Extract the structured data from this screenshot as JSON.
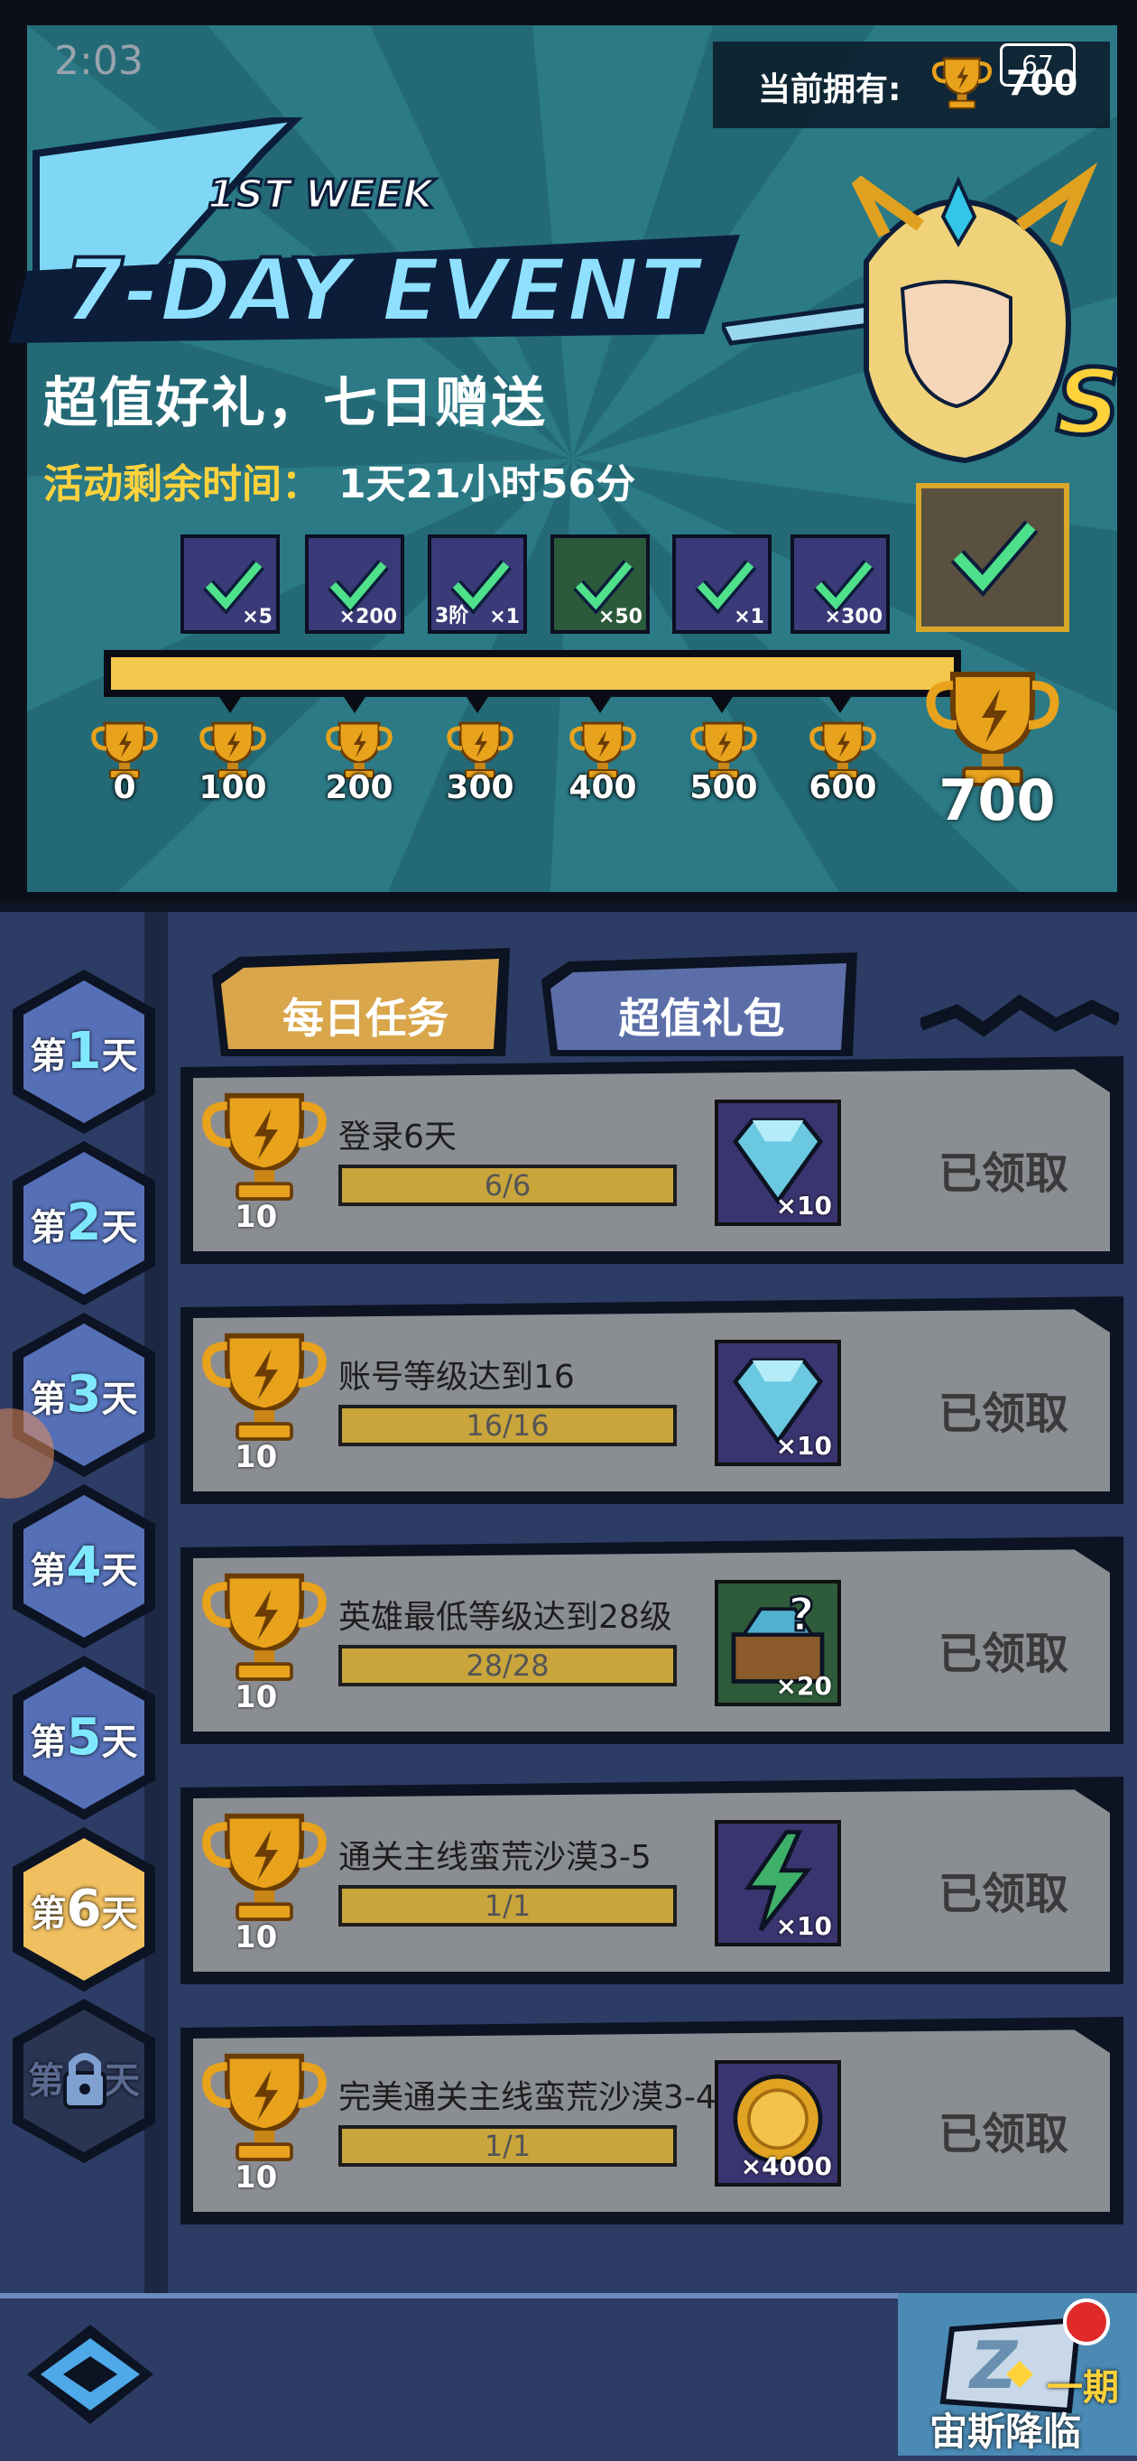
{
  "status_bar": {
    "time": "2:03",
    "battery": "67"
  },
  "header": {
    "own_label": "当前拥有:",
    "own_value": "700",
    "logo_week": "1ST WEEK",
    "logo_title": "7-DAY EVENT",
    "subtitle": "超值好礼，七日赠送",
    "timer_label": "活动剩余时间：",
    "timer_value": "1天21小时56分"
  },
  "rewards": [
    {
      "qty": "×5",
      "tier": "",
      "color": "#3a3a78"
    },
    {
      "qty": "×200",
      "tier": "",
      "color": "#3a3a78"
    },
    {
      "qty": "×1",
      "tier": "3阶",
      "color": "#3a3a78"
    },
    {
      "qty": "×50",
      "tier": "",
      "color": "#2b5a3a"
    },
    {
      "qty": "×1",
      "tier": "",
      "color": "#3a3a78"
    },
    {
      "qty": "×300",
      "tier": "",
      "color": "#3a3a78"
    }
  ],
  "milestones": [
    "0",
    "100",
    "200",
    "300",
    "400",
    "500",
    "600"
  ],
  "milestone_final": "700",
  "days": [
    {
      "prefix": "第",
      "num": "1",
      "suffix": "天",
      "state": "normal"
    },
    {
      "prefix": "第",
      "num": "2",
      "suffix": "天",
      "state": "normal"
    },
    {
      "prefix": "第",
      "num": "3",
      "suffix": "天",
      "state": "normal"
    },
    {
      "prefix": "第",
      "num": "4",
      "suffix": "天",
      "state": "normal"
    },
    {
      "prefix": "第",
      "num": "5",
      "suffix": "天",
      "state": "normal"
    },
    {
      "prefix": "第",
      "num": "6",
      "suffix": "天",
      "state": "active"
    },
    {
      "prefix": "第",
      "num": "",
      "suffix": "天",
      "state": "locked"
    }
  ],
  "tabs": {
    "daily": "每日任务",
    "gift": "超值礼包"
  },
  "tasks": [
    {
      "points": "10",
      "title": "登录6天",
      "progress": "6/6",
      "item_qty": "×10",
      "item_icon": "diamond-icon",
      "item_bg": "#3a3470",
      "status": "已领取"
    },
    {
      "points": "10",
      "title": "账号等级达到16",
      "progress": "16/16",
      "item_qty": "×10",
      "item_icon": "diamond-icon",
      "item_bg": "#3a3470",
      "status": "已领取"
    },
    {
      "points": "10",
      "title": "英雄最低等级达到28级",
      "progress": "28/28",
      "item_qty": "×20",
      "item_icon": "mystery-chest-icon",
      "item_bg": "#2e5c3a",
      "status": "已领取"
    },
    {
      "points": "10",
      "title": "通关主线蛮荒沙漠3-5",
      "progress": "1/1",
      "item_qty": "×10",
      "item_icon": "energy-bolt-icon",
      "item_bg": "#3a3470",
      "status": "已领取"
    },
    {
      "points": "10",
      "title": "完美通关主线蛮荒沙漠3-4",
      "progress": "1/1",
      "item_qty": "×4000",
      "item_icon": "gold-coin-icon",
      "item_bg": "#3a3470",
      "status": "已领取"
    }
  ],
  "bottom": {
    "zeus_label": "宙斯降临",
    "zeus_badge": "一期"
  }
}
